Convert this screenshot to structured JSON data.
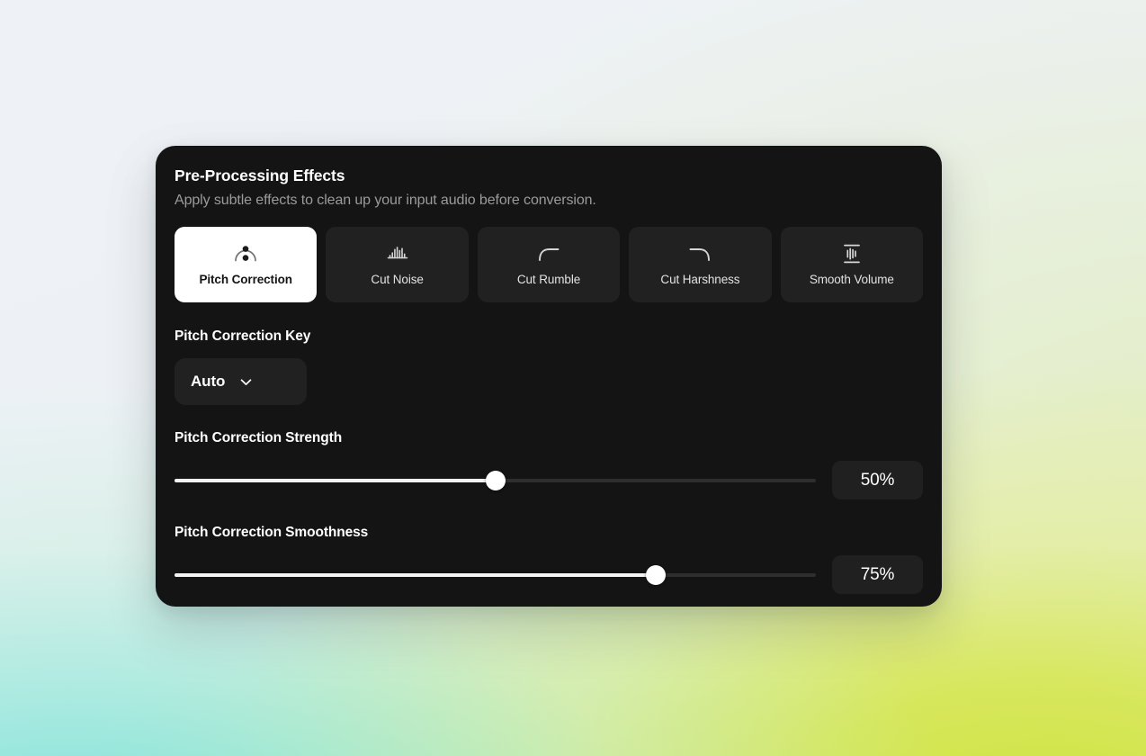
{
  "background": {
    "base_color": "#eef2f6",
    "accent_cyan": "#74e0db",
    "accent_lime": "#cee33c"
  },
  "panel": {
    "background_color": "#141414",
    "title": "Pre-Processing Effects",
    "subtitle": "Apply subtle effects to clean up your input audio before conversion."
  },
  "effects": {
    "tabs": [
      {
        "label": "Pitch Correction",
        "icon": "pitch-correction-icon",
        "selected": true
      },
      {
        "label": "Cut Noise",
        "icon": "noise-bars-icon",
        "selected": false
      },
      {
        "label": "Cut Rumble",
        "icon": "high-pass-curve-icon",
        "selected": false
      },
      {
        "label": "Cut Harshness",
        "icon": "low-pass-curve-icon",
        "selected": false
      },
      {
        "label": "Smooth Volume",
        "icon": "compressor-icon",
        "selected": false
      }
    ],
    "selected_index": 0,
    "selected_background": "#ffffff",
    "unselected_background": "#212121"
  },
  "key_setting": {
    "label": "Pitch Correction Key",
    "selected_value": "Auto",
    "chevron_icon": "chevron-down-icon"
  },
  "sliders": [
    {
      "label": "Pitch Correction Strength",
      "value": 50,
      "value_text": "50%",
      "min": 0,
      "max": 100,
      "fill_percent": "50%"
    },
    {
      "label": "Pitch Correction Smoothness",
      "value": 75,
      "value_text": "75%",
      "min": 0,
      "max": 100,
      "fill_percent": "75%"
    }
  ]
}
